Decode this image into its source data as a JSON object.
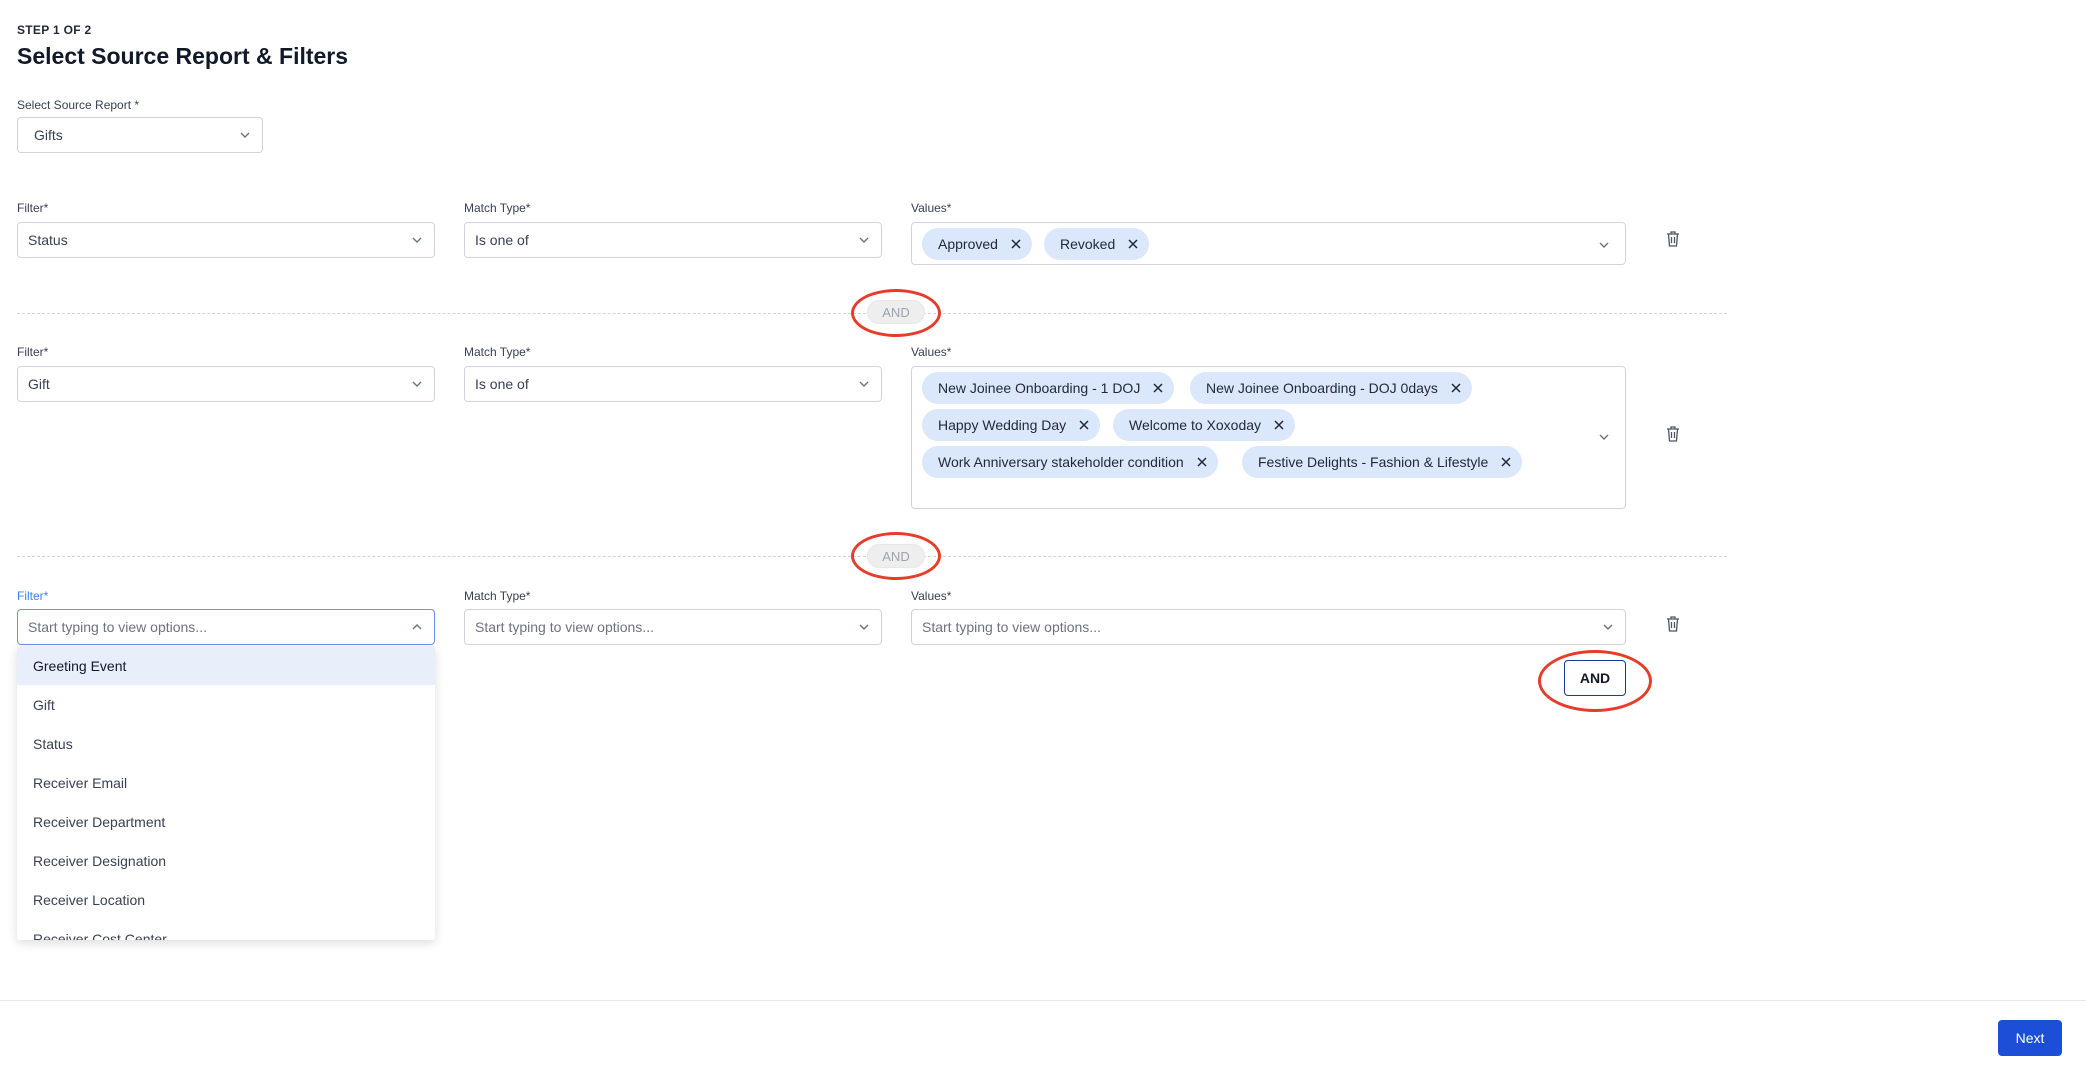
{
  "header": {
    "step": "STEP 1 OF 2",
    "title": "Select Source Report & Filters"
  },
  "source_report": {
    "label": "Select Source Report *",
    "value": "Gifts"
  },
  "filters": [
    {
      "filter_label": "Filter*",
      "filter_value": "Status",
      "match_label": "Match Type*",
      "match_value": "Is one of",
      "values_label": "Values*",
      "chips": [
        "Approved",
        "Revoked"
      ]
    },
    {
      "filter_label": "Filter*",
      "filter_value": "Gift",
      "match_label": "Match Type*",
      "match_value": "Is one of",
      "values_label": "Values*",
      "chips": [
        "New Joinee Onboarding - 1 DOJ",
        "New Joinee Onboarding - DOJ 0days",
        "Happy Wedding Day",
        "Welcome to Xoxoday",
        "Work Anniversary stakeholder condition",
        "Festive Delights - Fashion & Lifestyle"
      ]
    },
    {
      "filter_label": "Filter*",
      "filter_placeholder": "Start typing to view options...",
      "match_label": "Match Type*",
      "match_placeholder": "Start typing to view options...",
      "values_label": "Values*",
      "values_placeholder": "Start typing to view options..."
    }
  ],
  "connectors": [
    "AND",
    "AND"
  ],
  "add_and_button": "AND",
  "dropdown_options": [
    "Greeting Event",
    "Gift",
    "Status",
    "Receiver Email",
    "Receiver Department",
    "Receiver Designation",
    "Receiver Location",
    "Receiver Cost Center"
  ],
  "footer": {
    "next_label": "Next"
  },
  "colors": {
    "primary": "#1d4ed8",
    "chip_bg": "#dbe7fb",
    "annotation_ring": "#e53d2a",
    "focus_border": "#6b93e8"
  },
  "icons": [
    "chevron-down-icon",
    "chevron-up-icon",
    "close-icon",
    "trash-icon"
  ]
}
